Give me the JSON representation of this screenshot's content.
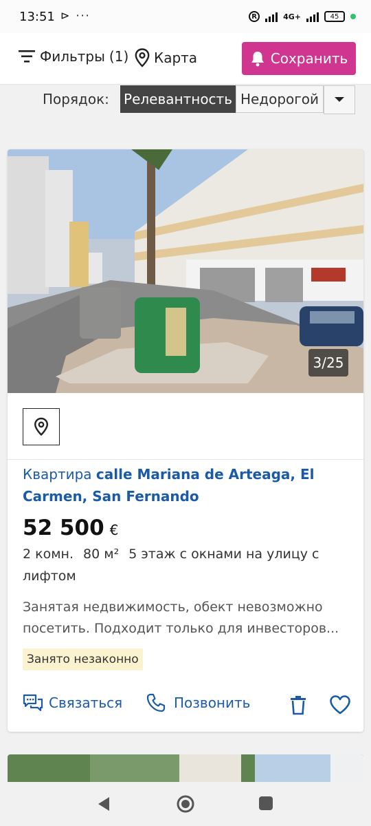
{
  "status_bar": {
    "time": "13:51",
    "left_icons": "⊳ ···",
    "network": "4G+",
    "battery": "45"
  },
  "toolbar": {
    "filters_label": "Фильтры",
    "filters_count": "(1)",
    "map_label": "Карта",
    "save_label": "Сохранить"
  },
  "sort": {
    "label": "Порядок:",
    "options": [
      "Релевантность",
      "Недорогой"
    ],
    "selected": "Релевантность"
  },
  "listing": {
    "photo_counter": "3/25",
    "title_prefix": "Квартира",
    "title_address": "calle Mariana de Arteaga, El Carmen, San Fernando",
    "price": "52 500",
    "currency": "€",
    "rooms": "2 комн.",
    "area": "80 м²",
    "floor": "5 этаж с окнами на улицу с лифтом",
    "description": "Занятая недвижимость, обект невозможно посетить. Подходит только для инвесторов...",
    "badge": "Занято незаконно",
    "contact_label": "Связаться",
    "call_label": "Позвонить"
  },
  "colors": {
    "accent": "#d0368f",
    "link": "#1a5aa8",
    "badge_bg": "#fbf3cf",
    "sort_active_bg": "#444444"
  },
  "icons": [
    "filter-icon",
    "map-pin-icon",
    "bell-icon",
    "chevron-down-icon",
    "location-pin-icon",
    "chat-icon",
    "phone-icon",
    "trash-icon",
    "heart-icon",
    "back-icon",
    "home-icon",
    "recent-apps-icon"
  ]
}
